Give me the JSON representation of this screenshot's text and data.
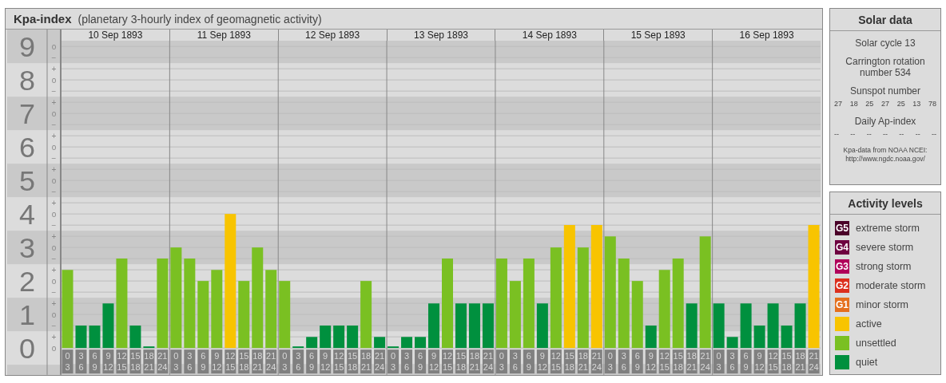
{
  "kpa_panel": {
    "title": "Kpa-index",
    "subtitle": "(planetary 3-hourly index of geomagnetic activity)",
    "days": [
      {
        "label": "10 Sep 1893",
        "slots": [
          {
            "from": "0",
            "to": "3"
          },
          {
            "from": "3",
            "to": "6"
          },
          {
            "from": "6",
            "to": "9"
          },
          {
            "from": "9",
            "to": "12"
          },
          {
            "from": "12",
            "to": "15"
          },
          {
            "from": "15",
            "to": "18"
          },
          {
            "from": "18",
            "to": "21"
          },
          {
            "from": "21",
            "to": "24"
          }
        ]
      },
      {
        "label": "11 Sep 1893",
        "slots": [
          {
            "from": "0",
            "to": "3"
          },
          {
            "from": "3",
            "to": "6"
          },
          {
            "from": "6",
            "to": "9"
          },
          {
            "from": "9",
            "to": "12"
          },
          {
            "from": "12",
            "to": "15"
          },
          {
            "from": "15",
            "to": "18"
          },
          {
            "from": "18",
            "to": "21"
          },
          {
            "from": "21",
            "to": "24"
          }
        ]
      },
      {
        "label": "12 Sep 1893",
        "slots": [
          {
            "from": "0",
            "to": "3"
          },
          {
            "from": "3",
            "to": "6"
          },
          {
            "from": "6",
            "to": "9"
          },
          {
            "from": "9",
            "to": "12"
          },
          {
            "from": "12",
            "to": "15"
          },
          {
            "from": "15",
            "to": "18"
          },
          {
            "from": "18",
            "to": "21"
          },
          {
            "from": "21",
            "to": "24"
          }
        ]
      },
      {
        "label": "13 Sep 1893",
        "slots": [
          {
            "from": "0",
            "to": "3"
          },
          {
            "from": "3",
            "to": "6"
          },
          {
            "from": "6",
            "to": "9"
          },
          {
            "from": "9",
            "to": "12"
          },
          {
            "from": "12",
            "to": "15"
          },
          {
            "from": "15",
            "to": "18"
          },
          {
            "from": "18",
            "to": "21"
          },
          {
            "from": "21",
            "to": "24"
          }
        ]
      },
      {
        "label": "14 Sep 1893",
        "slots": [
          {
            "from": "0",
            "to": "3"
          },
          {
            "from": "3",
            "to": "6"
          },
          {
            "from": "6",
            "to": "9"
          },
          {
            "from": "9",
            "to": "12"
          },
          {
            "from": "12",
            "to": "15"
          },
          {
            "from": "15",
            "to": "18"
          },
          {
            "from": "18",
            "to": "21"
          },
          {
            "from": "21",
            "to": "24"
          }
        ]
      },
      {
        "label": "15 Sep 1893",
        "slots": [
          {
            "from": "0",
            "to": "3"
          },
          {
            "from": "3",
            "to": "6"
          },
          {
            "from": "6",
            "to": "9"
          },
          {
            "from": "9",
            "to": "12"
          },
          {
            "from": "12",
            "to": "15"
          },
          {
            "from": "15",
            "to": "18"
          },
          {
            "from": "18",
            "to": "21"
          },
          {
            "from": "21",
            "to": "24"
          }
        ]
      },
      {
        "label": "16 Sep 1893",
        "slots": [
          {
            "from": "0",
            "to": "3"
          },
          {
            "from": "3",
            "to": "6"
          },
          {
            "from": "6",
            "to": "9"
          },
          {
            "from": "9",
            "to": "12"
          },
          {
            "from": "12",
            "to": "15"
          },
          {
            "from": "15",
            "to": "18"
          },
          {
            "from": "18",
            "to": "21"
          },
          {
            "from": "21",
            "to": "24"
          }
        ]
      }
    ],
    "chart_data": {
      "type": "bar",
      "stacked": true,
      "grid": true,
      "ylim": [
        -0.8,
        9.17
      ],
      "yticks": [
        9,
        8,
        7,
        6,
        5,
        4,
        3,
        2,
        1,
        0
      ],
      "annotations": [
        "o",
        "−",
        "+",
        "o",
        "−",
        "+",
        "o",
        "−",
        "+",
        "o",
        "−",
        "+",
        "o",
        "−",
        "+",
        "o",
        "−",
        "+",
        "o",
        "−",
        "+",
        "o",
        "−",
        "+",
        "o",
        "−",
        "+",
        "o"
      ],
      "series": [
        {
          "color": "#00903e",
          "values": [
            null,
            0.67,
            0.67,
            1.33,
            null,
            0.67,
            0,
            null,
            null,
            null,
            null,
            null,
            null,
            null,
            null,
            null,
            null,
            0,
            0.33,
            0.67,
            0.67,
            0.67,
            null,
            0.33,
            0,
            0.33,
            0.33,
            1.33,
            null,
            1.33,
            1.33,
            1.33,
            null,
            null,
            null,
            1.33,
            null,
            null,
            null,
            null,
            null,
            null,
            null,
            0.67,
            null,
            null,
            1.33,
            null,
            1.33,
            0.33,
            1.33,
            0.67,
            1.33,
            0.67,
            1.33,
            null
          ]
        },
        {
          "color": "#7ac022",
          "values": [
            2.33,
            null,
            null,
            null,
            2.67,
            null,
            null,
            2.67,
            3,
            2.67,
            2,
            2.33,
            null,
            2,
            3,
            2.33,
            2,
            null,
            null,
            null,
            null,
            null,
            2,
            null,
            null,
            null,
            null,
            null,
            2.67,
            null,
            null,
            null,
            2.67,
            2,
            2.67,
            null,
            3,
            null,
            3,
            null,
            3.33,
            2.67,
            2,
            null,
            2.33,
            2.67,
            null,
            3.33,
            null,
            null,
            null,
            null,
            null,
            null,
            null,
            null
          ]
        },
        {
          "color": "#f8c400",
          "values": [
            null,
            null,
            null,
            null,
            null,
            null,
            null,
            null,
            null,
            null,
            null,
            null,
            4,
            null,
            null,
            null,
            null,
            null,
            null,
            null,
            null,
            null,
            null,
            null,
            null,
            null,
            null,
            null,
            null,
            null,
            null,
            null,
            null,
            null,
            null,
            null,
            null,
            3.67,
            null,
            3.67,
            null,
            null,
            null,
            null,
            null,
            null,
            null,
            null,
            null,
            null,
            null,
            null,
            null,
            null,
            null,
            3.67
          ]
        }
      ]
    }
  },
  "solar_data": {
    "title": "Solar data",
    "cycle": "Solar cycle 13",
    "rotation": "Carrington rotation number 534",
    "sunspot_title": "Sunspot number",
    "sunspots": [
      "27",
      "18",
      "25",
      "27",
      "25",
      "13",
      "78"
    ],
    "ap_title": "Daily Ap-index",
    "ap_values": [
      "--",
      "--",
      "--",
      "--",
      "--",
      "--",
      "--"
    ],
    "source": "Kpa-data from NOAA NCEI: http://www.ngdc.noaa.gov/"
  },
  "activity_levels": {
    "title": "Activity levels",
    "items": [
      {
        "badge": "G5",
        "label": "extreme storm",
        "color": "#4a0028"
      },
      {
        "badge": "G4",
        "label": "severe storm",
        "color": "#6e0040"
      },
      {
        "badge": "G3",
        "label": "strong storm",
        "color": "#b0005a"
      },
      {
        "badge": "G2",
        "label": "moderate storm",
        "color": "#dc2f1e"
      },
      {
        "badge": "G1",
        "label": "minor storm",
        "color": "#e5701e"
      },
      {
        "label": "active",
        "color": "#f8c400"
      },
      {
        "label": "unsettled",
        "color": "#7ac022"
      },
      {
        "label": "quiet",
        "color": "#00903e"
      }
    ]
  }
}
